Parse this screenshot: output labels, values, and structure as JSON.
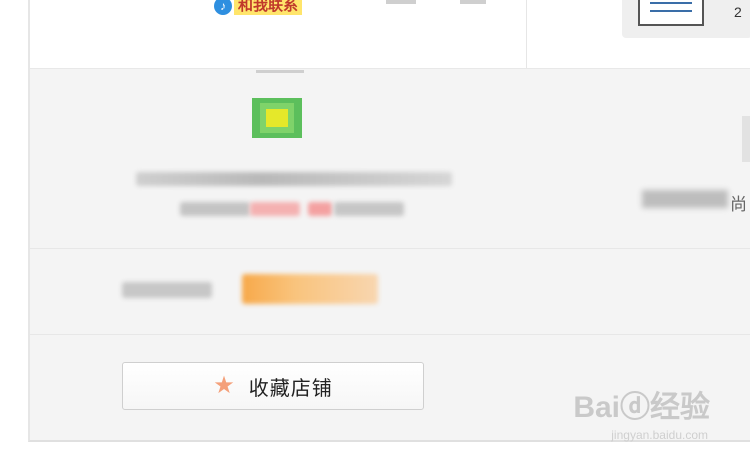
{
  "header": {
    "contact_badge_icon": "qq-icon",
    "contact_badge_label": "和我联系",
    "corner_text": "2"
  },
  "shop": {
    "right_label": "尚"
  },
  "actions": {
    "favorite_icon": "star-icon",
    "favorite_label": "收藏店铺"
  },
  "watermark": {
    "brand": "Baiⓓ经验",
    "url": "jingyan.baidu.com"
  },
  "colors": {
    "panel_bg": "#f4f4f4",
    "star": "#f4a07a",
    "badge_bg": "#ffe56b",
    "badge_text": "#c0392b",
    "highlight": "#f7a94a",
    "pink": "#f4a1a1"
  }
}
